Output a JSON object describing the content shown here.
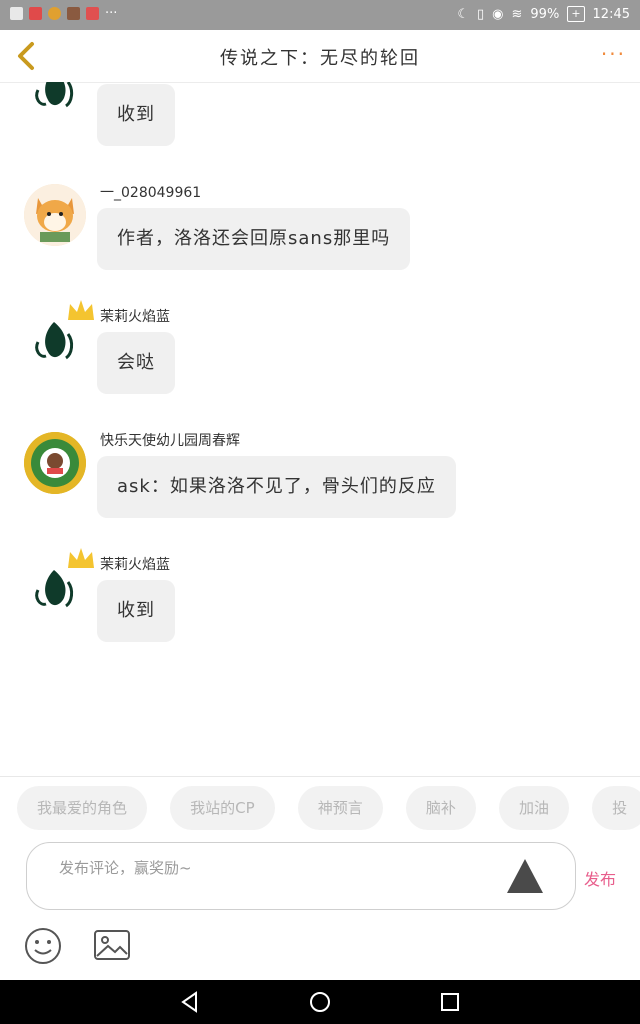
{
  "status_bar": {
    "battery": "99%",
    "time": "12:45",
    "extra": "···"
  },
  "header": {
    "title": "传说之下：无尽的轮回",
    "more": "···"
  },
  "messages": [
    {
      "user": "",
      "text": "收到",
      "avatar": "ink-figure-icon",
      "crown": false
    },
    {
      "user": "一_028049961",
      "text": "作者，洛洛还会回原sans那里吗",
      "avatar": "shiba-dog-icon",
      "crown": false
    },
    {
      "user": "茉莉火焰蓝",
      "text": "会哒",
      "avatar": "ink-figure-icon",
      "crown": true
    },
    {
      "user": "快乐天使幼儿园周春辉",
      "text": "ask：如果洛洛不见了，骨头们的反应",
      "avatar": "kindergarten-badge-icon",
      "crown": false
    },
    {
      "user": "茉莉火焰蓝",
      "text": "收到",
      "avatar": "ink-figure-icon",
      "crown": true
    }
  ],
  "quick_tags": [
    "我最爱的角色",
    "我站的CP",
    "神预言",
    "脑补",
    "加油",
    "投"
  ],
  "comment": {
    "placeholder": "发布评论，赢奖励~",
    "publish_label": "发布"
  },
  "colors": {
    "accent": "#f08a3c",
    "publish": "#e85e8c",
    "bubble": "#f0f0f0"
  }
}
